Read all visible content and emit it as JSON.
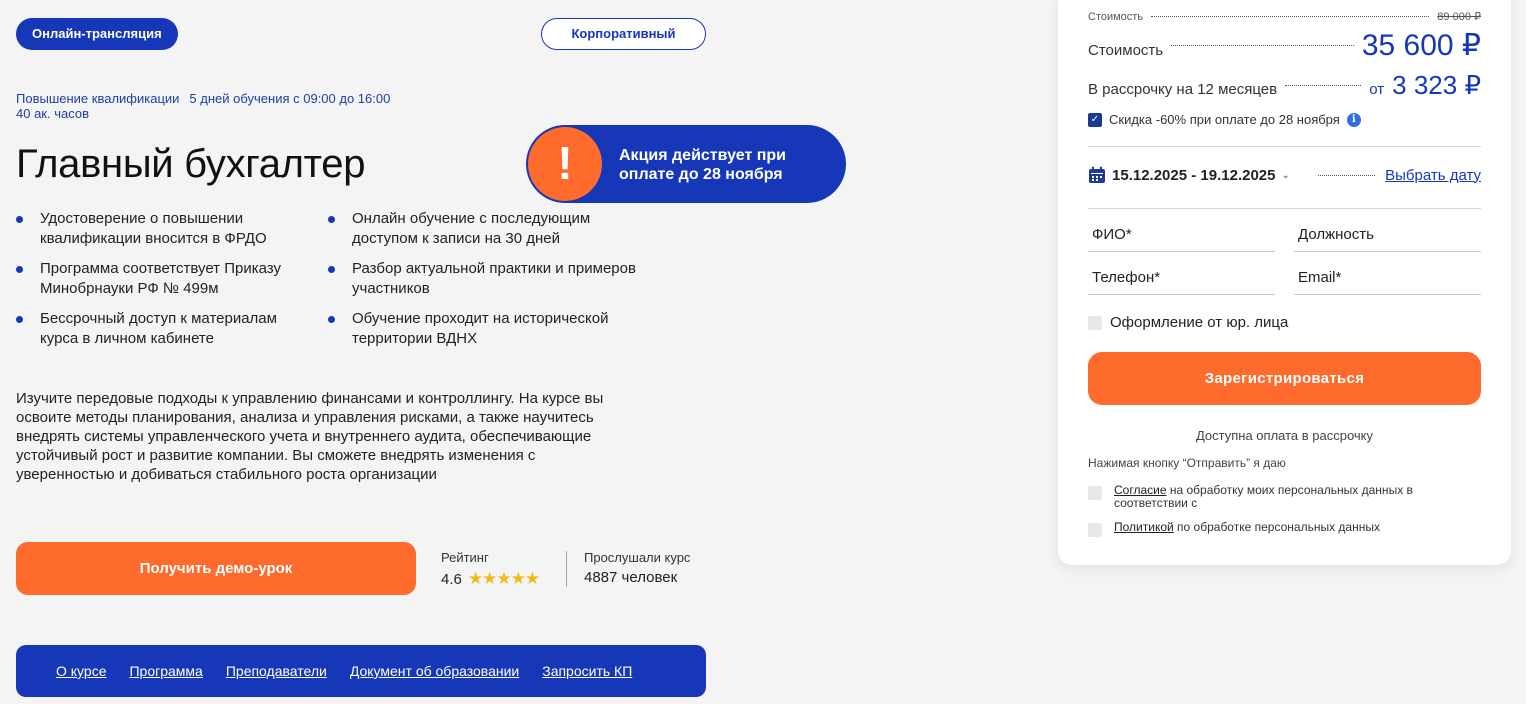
{
  "badges": {
    "online": "Онлайн-трансляция",
    "corporate": "Корпоративный"
  },
  "meta": {
    "type": "Повышение квалификации",
    "schedule": "5 дней обучения с 09:00 до 16:00",
    "hours": "40 ак. часов"
  },
  "title": "Главный бухгалтер",
  "promo": {
    "icon": "!",
    "text": "Акция действует при оплате до 28 ноября"
  },
  "features": {
    "col1": [
      "Удостоверение о повышении квалификации вносится в ФРДО",
      "Программа соответствует Приказу Минобрнауки РФ № 499м",
      "Бессрочный доступ к материалам курса в личном кабинете"
    ],
    "col2": [
      "Онлайн обучение с последующим доступом к записи на 30 дней",
      "Разбор актуальной практики и примеров участников",
      "Обучение проходит на исторической территории ВДНХ"
    ]
  },
  "description": "Изучите передовые подходы к управлению финансами и контроллингу. На курсе вы освоите методы планирования, анализа и управления рисками, а также научитесь внедрять системы управленческого учета и внутреннего аудита, обеспечивающие устойчивый рост и развитие компании. Вы сможете внедрять изменения с уверенностью и добиваться стабильного роста организации",
  "demo_button": "Получить демо-урок",
  "rating": {
    "label": "Рейтинг",
    "value": "4.6",
    "stars": "★★★★★"
  },
  "listeners": {
    "label": "Прослушали курс",
    "value": "4887 человек"
  },
  "nav": [
    "О курсе",
    "Программа",
    "Преподаватели",
    "Документ об образовании",
    "Запросить КП"
  ],
  "pricing": {
    "old_label": "Стоимость",
    "old_price": "89 000 ₽",
    "label": "Стоимость",
    "price": "35 600 ₽",
    "installment_label": "В рассрочку на 12 месяцев",
    "installment_from": "от",
    "installment_price": "3 323 ₽",
    "discount": "Скидка -60% при оплате до 28 ноября",
    "discount_checked": true
  },
  "date": {
    "range": "15.12.2025 - 19.12.2025",
    "pick": "Выбрать дату"
  },
  "form": {
    "fio": "ФИО*",
    "position": "Должность",
    "phone": "Телефон*",
    "email": "Email*",
    "legal_entity": "Оформление от юр. лица",
    "submit": "Зарегистрироваться",
    "installment_note": "Доступна оплата в рассрочку",
    "agree_intro": "Нажимая кнопку “Отправить” я даю",
    "consent_link": "Согласие",
    "consent_text": " на обработку моих персональных данных в соответствии с",
    "policy_link": "Политикой",
    "policy_text": " по обработке персональных данных"
  },
  "colors": {
    "brand_blue": "#1638b8",
    "accent_orange": "#ff6b2c",
    "background": "#f4f4f4"
  }
}
